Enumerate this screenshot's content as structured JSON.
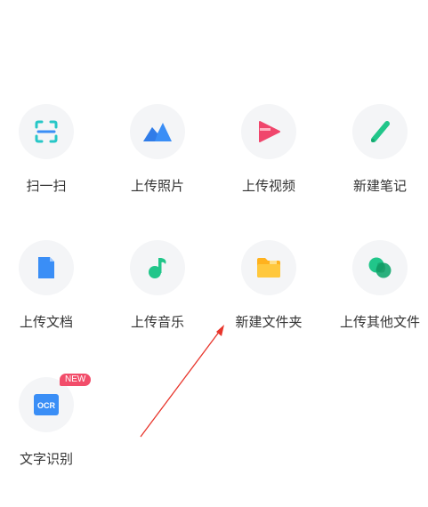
{
  "actions": [
    {
      "label": "扫一扫",
      "icon": "scan-icon"
    },
    {
      "label": "上传照片",
      "icon": "photo-mountain-icon"
    },
    {
      "label": "上传视频",
      "icon": "video-play-icon"
    },
    {
      "label": "新建笔记",
      "icon": "pen-note-icon"
    },
    {
      "label": "上传文档",
      "icon": "document-icon"
    },
    {
      "label": "上传音乐",
      "icon": "music-note-icon"
    },
    {
      "label": "新建文件夹",
      "icon": "folder-icon"
    },
    {
      "label": "上传其他文件",
      "icon": "other-files-icon"
    },
    {
      "label": "文字识别",
      "icon": "ocr-icon",
      "icon_text": "OCR",
      "badge": "NEW"
    }
  ],
  "colors": {
    "accent_blue": "#3a8ef6",
    "accent_green": "#21c68a",
    "accent_pink": "#f0466c",
    "folder_yellow": "#ffc83d",
    "badge_red": "#f24d6a",
    "annotation_arrow": "#e8352b"
  }
}
